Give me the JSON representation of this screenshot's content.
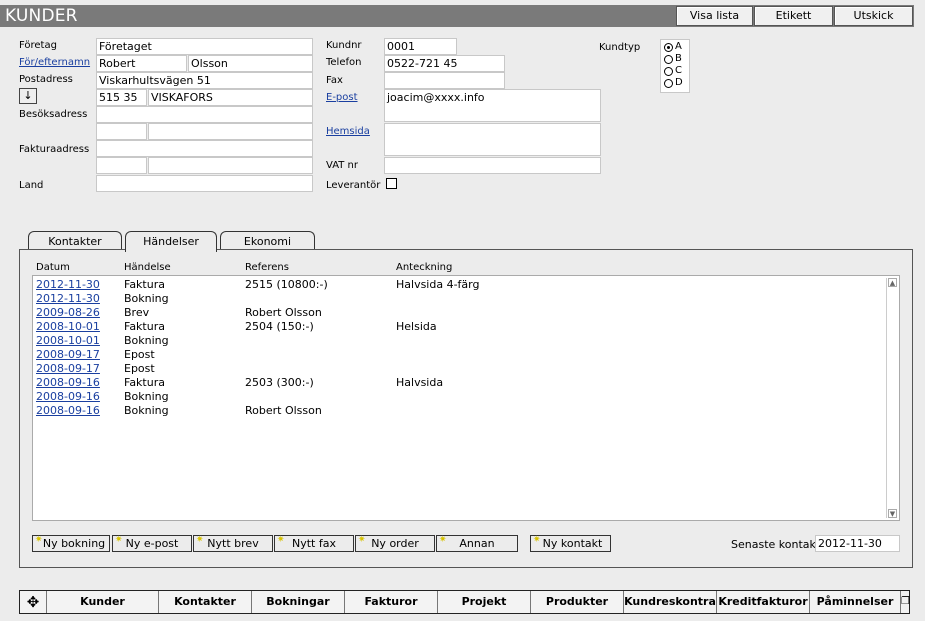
{
  "app": {
    "title": "KUNDER"
  },
  "toolbar": {
    "visa_lista": "Visa lista",
    "etikett": "Etikett",
    "utskick": "Utskick"
  },
  "form": {
    "foretag_label": "Företag",
    "foretag_value": "Företaget",
    "namn_label": "För/efternamn",
    "fornamn_value": "Robert",
    "efternamn_value": "Olsson",
    "postadress_label": "Postadress",
    "postadress_value": "Viskarhultsvägen 51",
    "arrow_glyph": "↓",
    "postnr_value": "515 35",
    "ort_value": "VISKAFORS",
    "besoksadress_label": "Besöksadress",
    "fakturaadress_label": "Fakturaadress",
    "land_label": "Land",
    "kundnr_label": "Kundnr",
    "kundnr_value": "0001",
    "telefon_label": "Telefon",
    "telefon_value": "0522-721 45",
    "fax_label": "Fax",
    "epost_label": "E-post",
    "epost_value": "joacim@xxxx.info",
    "hemsida_label": "Hemsida",
    "vat_label": "VAT nr",
    "leverantor_label": "Leverantör",
    "kundtyp_label": "Kundtyp",
    "kundtyp_options": [
      "A",
      "B",
      "C",
      "D"
    ],
    "kundtyp_selected": "A"
  },
  "tabs": [
    {
      "label": "Kontakter",
      "active": false
    },
    {
      "label": "Händelser",
      "active": true
    },
    {
      "label": "Ekonomi",
      "active": false
    }
  ],
  "events": {
    "columns": [
      "Datum",
      "Händelse",
      "Referens",
      "Anteckning"
    ],
    "rows": [
      {
        "datum": "2012-11-30",
        "handelse": "Faktura",
        "referens": "2515 (10800:-)",
        "anteckning": "Halvsida 4-färg"
      },
      {
        "datum": "2012-11-30",
        "handelse": "Bokning",
        "referens": "",
        "anteckning": ""
      },
      {
        "datum": "2009-08-26",
        "handelse": "Brev",
        "referens": "Robert Olsson",
        "anteckning": ""
      },
      {
        "datum": "2008-10-01",
        "handelse": "Faktura",
        "referens": "2504 (150:-)",
        "anteckning": "Helsida"
      },
      {
        "datum": "2008-10-01",
        "handelse": "Bokning",
        "referens": "",
        "anteckning": ""
      },
      {
        "datum": "2008-09-17",
        "handelse": "Epost",
        "referens": "",
        "anteckning": ""
      },
      {
        "datum": "2008-09-17",
        "handelse": "Epost",
        "referens": "",
        "anteckning": ""
      },
      {
        "datum": "2008-09-16",
        "handelse": "Faktura",
        "referens": "2503 (300:-)",
        "anteckning": "Halvsida"
      },
      {
        "datum": "2008-09-16",
        "handelse": "Bokning",
        "referens": "",
        "anteckning": ""
      },
      {
        "datum": "2008-09-16",
        "handelse": "Bokning",
        "referens": "Robert Olsson",
        "anteckning": ""
      }
    ]
  },
  "actions": {
    "ny_bokning": "Ny bokning",
    "ny_epost": "Ny e-post",
    "nytt_brev": "Nytt brev",
    "nytt_fax": "Nytt fax",
    "ny_order": "Ny order",
    "annan": "Annan",
    "ny_kontakt": "Ny kontakt",
    "star_glyph": "✷"
  },
  "senaste": {
    "label": "Senaste kontakt",
    "value": "2012-11-30"
  },
  "nav": {
    "move_glyph": "✥",
    "items": [
      "Kunder",
      "Kontakter",
      "Bokningar",
      "Fakturor",
      "Projekt",
      "Produkter",
      "Kundreskontra",
      "Kreditfakturor",
      "Påminnelser"
    ],
    "window_glyph": "❐"
  },
  "colors": {
    "titlebar": "#7a7a7a",
    "link": "#1a3fa0",
    "star": "#d8c400"
  }
}
